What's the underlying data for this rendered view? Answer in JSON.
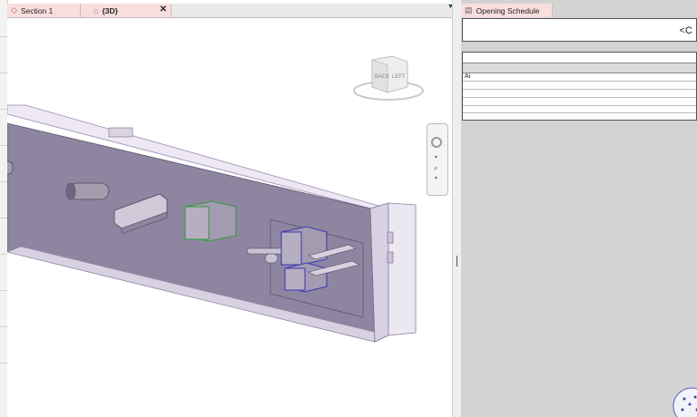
{
  "tabs": [
    {
      "label": "Section 1",
      "icon": "section-view-icon"
    },
    {
      "label": "{3D}",
      "icon": "3d-view-icon"
    }
  ],
  "right_tab": {
    "label": "Opening Schedule",
    "icon": "schedule-icon"
  },
  "schedule": {
    "title_fragment": "<C",
    "first_cell": "Ai"
  },
  "viewcube": {
    "face_back": "BACK",
    "face_left": "LEFT"
  },
  "close_glyph": "✕",
  "dropdown_glyph": "▼"
}
